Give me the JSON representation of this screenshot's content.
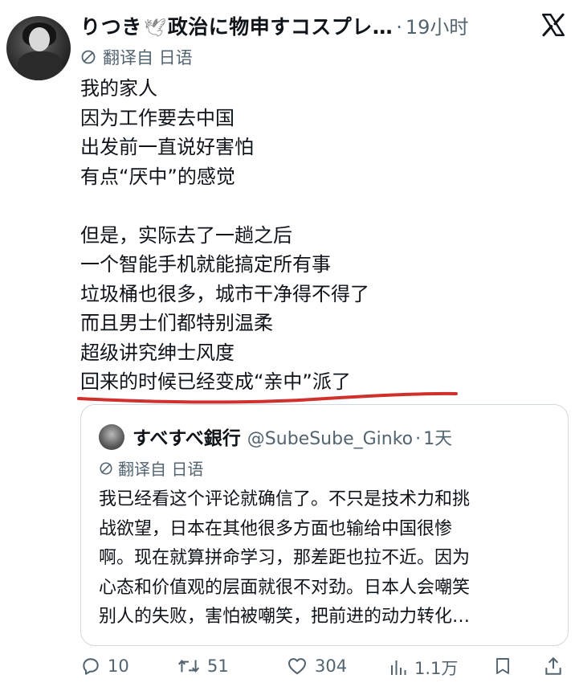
{
  "tweet": {
    "author_name": "りつき",
    "author_name_suffix": "政治に物申すコスプレ…",
    "dove_emoji": "🕊",
    "separator": "·",
    "time": "19小时",
    "translated_from": "翻译自 日语",
    "lines": [
      "我的家人",
      "因为工作要去中国",
      "出发前一直说好害怕",
      "有点“厌中”的感觉",
      "",
      "但是，实际去了一趟之后",
      "一个智能手机就能搞定所有事",
      "垃圾桶也很多，城市干净得不得了",
      "而且男士们都特别温柔",
      "超级讲究绅士风度",
      "回来的时候已经变成“亲中”派了"
    ],
    "underline_color": "#d0312d"
  },
  "quote": {
    "author_name": "すべすべ銀行",
    "handle": "@SubeSube_Ginko",
    "separator": "·",
    "time": "1天",
    "translated_from": "翻译自 日语",
    "lines": [
      "我已经看这个评论就确信了。不只是技术力和挑",
      "战欲望，日本在其他很多方面也输给中国很惨",
      "啊。现在就算拼命学习，那差距也拉不近。因为",
      "心态和价值观的层面就很不对劲。日本人会嘲笑",
      "别人的失败，害怕被嘲笑，把前进的动力转化…"
    ]
  },
  "actions": {
    "replies": "10",
    "reposts": "51",
    "likes": "304",
    "views": "1.1万"
  },
  "icons": [
    "x-logo-icon",
    "translate-icon",
    "reply-icon",
    "repost-icon",
    "like-icon",
    "views-icon",
    "bookmark-icon",
    "share-icon"
  ]
}
